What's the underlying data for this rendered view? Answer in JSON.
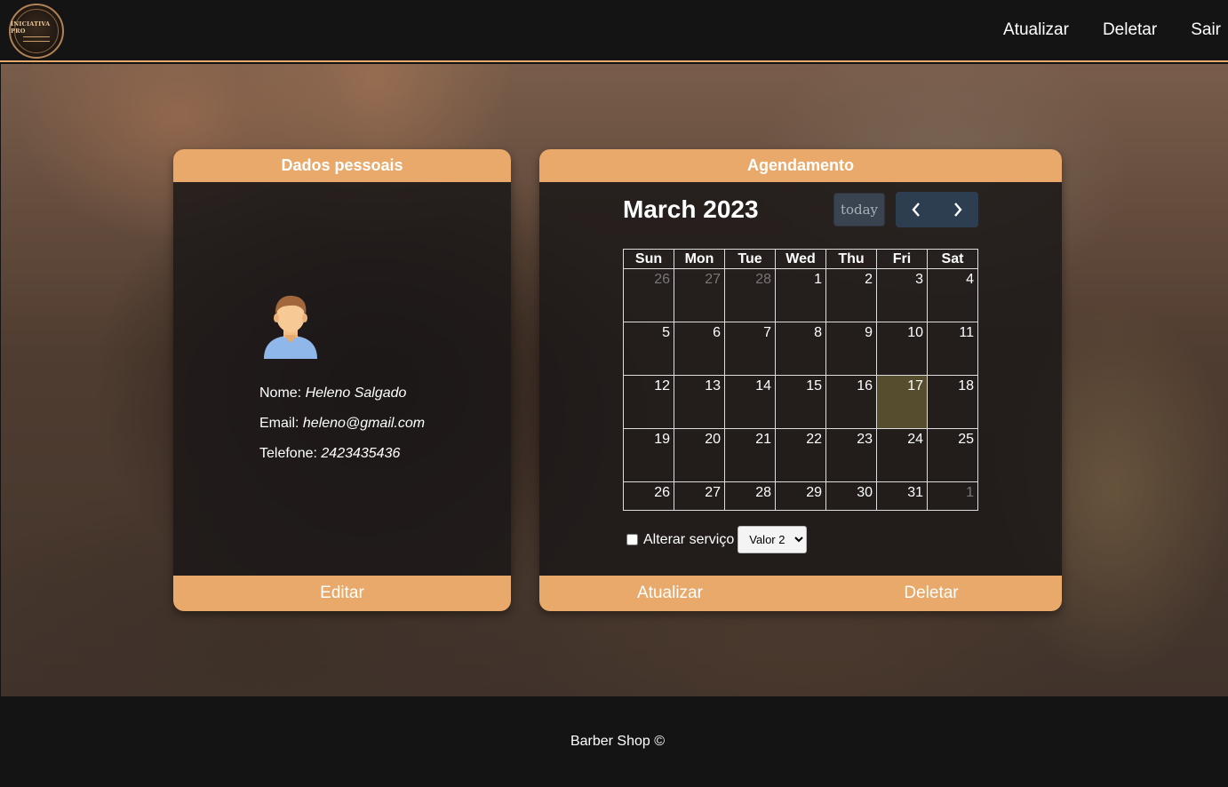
{
  "header": {
    "logo_text": "INICIATIVA PRO",
    "nav": [
      "Atualizar",
      "Deletar",
      "Sair"
    ]
  },
  "personal": {
    "title": "Dados pessoais",
    "name_label": "Nome:",
    "name_value": "Heleno Salgado",
    "email_label": "Email:",
    "email_value": "heleno@gmail.com",
    "phone_label": "Telefone:",
    "phone_value": "2423435436",
    "edit_label": "Editar",
    "avatar_icon": "user-avatar-icon"
  },
  "schedule": {
    "title": "Agendamento",
    "month_title": "March 2023",
    "today_label": "today",
    "prev_icon": "chevron-left-icon",
    "next_icon": "chevron-right-icon",
    "weekdays": [
      "Sun",
      "Mon",
      "Tue",
      "Wed",
      "Thu",
      "Fri",
      "Sat"
    ],
    "weeks": [
      [
        {
          "d": "26",
          "other": true
        },
        {
          "d": "27",
          "other": true
        },
        {
          "d": "28",
          "other": true
        },
        {
          "d": "1"
        },
        {
          "d": "2"
        },
        {
          "d": "3"
        },
        {
          "d": "4"
        }
      ],
      [
        {
          "d": "5"
        },
        {
          "d": "6"
        },
        {
          "d": "7"
        },
        {
          "d": "8"
        },
        {
          "d": "9"
        },
        {
          "d": "10"
        },
        {
          "d": "11"
        }
      ],
      [
        {
          "d": "12"
        },
        {
          "d": "13"
        },
        {
          "d": "14"
        },
        {
          "d": "15"
        },
        {
          "d": "16"
        },
        {
          "d": "17",
          "today": true
        },
        {
          "d": "18"
        }
      ],
      [
        {
          "d": "19"
        },
        {
          "d": "20"
        },
        {
          "d": "21"
        },
        {
          "d": "22"
        },
        {
          "d": "23"
        },
        {
          "d": "24"
        },
        {
          "d": "25"
        }
      ],
      [
        {
          "d": "26"
        },
        {
          "d": "27"
        },
        {
          "d": "28"
        },
        {
          "d": "29"
        },
        {
          "d": "30"
        },
        {
          "d": "31"
        },
        {
          "d": "1",
          "other": true
        }
      ]
    ],
    "alter_label": "Alterar serviço",
    "alter_checked": false,
    "service_selected": "Valor 2",
    "update_label": "Atualizar",
    "delete_label": "Deletar"
  },
  "footer": {
    "text": "Barber Shop ©"
  },
  "colors": {
    "accent": "#e8a96b",
    "header_bg": "#141414",
    "nav_button_bg": "#2c3e50",
    "today_highlight": "#b4aa50"
  }
}
